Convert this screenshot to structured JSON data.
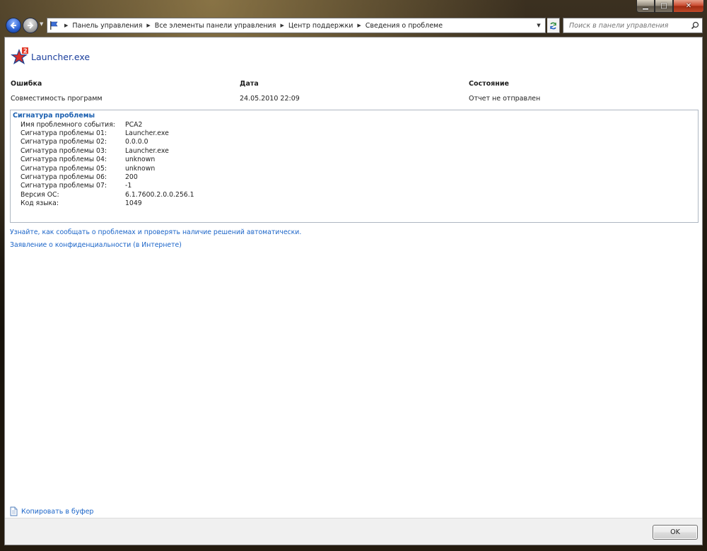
{
  "window": {
    "caption_buttons": {
      "minimize": "▁",
      "maximize": "□",
      "close": "✕"
    }
  },
  "navigation": {
    "breadcrumbs": [
      "Панель управления",
      "Все элементы панели управления",
      "Центр поддержки",
      "Сведения о проблеме"
    ],
    "search_placeholder": "Поиск в панели управления"
  },
  "report": {
    "app_name": "Launcher.exe",
    "columns": [
      {
        "header": "Ошибка",
        "value": "Совместимость программ"
      },
      {
        "header": "Дата",
        "value": "24.05.2010 22:09"
      },
      {
        "header": "Состояние",
        "value": "Отчет не отправлен"
      }
    ],
    "signature_title": "Сигнатура проблемы",
    "signature": [
      {
        "label": "Имя проблемного события:",
        "value": "PCA2"
      },
      {
        "label": "Сигнатура проблемы 01:",
        "value": "Launcher.exe"
      },
      {
        "label": "Сигнатура проблемы 02:",
        "value": "0.0.0.0"
      },
      {
        "label": "Сигнатура проблемы 03:",
        "value": "Launcher.exe"
      },
      {
        "label": "Сигнатура проблемы 04:",
        "value": "unknown"
      },
      {
        "label": "Сигнатура проблемы 05:",
        "value": "unknown"
      },
      {
        "label": "Сигнатура проблемы 06:",
        "value": "200"
      },
      {
        "label": "Сигнатура проблемы 07:",
        "value": "-1"
      },
      {
        "label": "Версия ОС:",
        "value": "6.1.7600.2.0.0.256.1"
      },
      {
        "label": "Код языка:",
        "value": "1049"
      }
    ]
  },
  "links": {
    "learn": "Узнайте, как сообщать о проблемах и проверять наличие решений автоматически.",
    "privacy": "Заявление о конфиденциальности (в Интернете)"
  },
  "footer": {
    "copy_label": "Копировать в буфер",
    "ok_label": "OK"
  },
  "colors": {
    "link": "#1a64c8",
    "title": "#1a3e9c",
    "signature_title": "#1a5fb0"
  }
}
